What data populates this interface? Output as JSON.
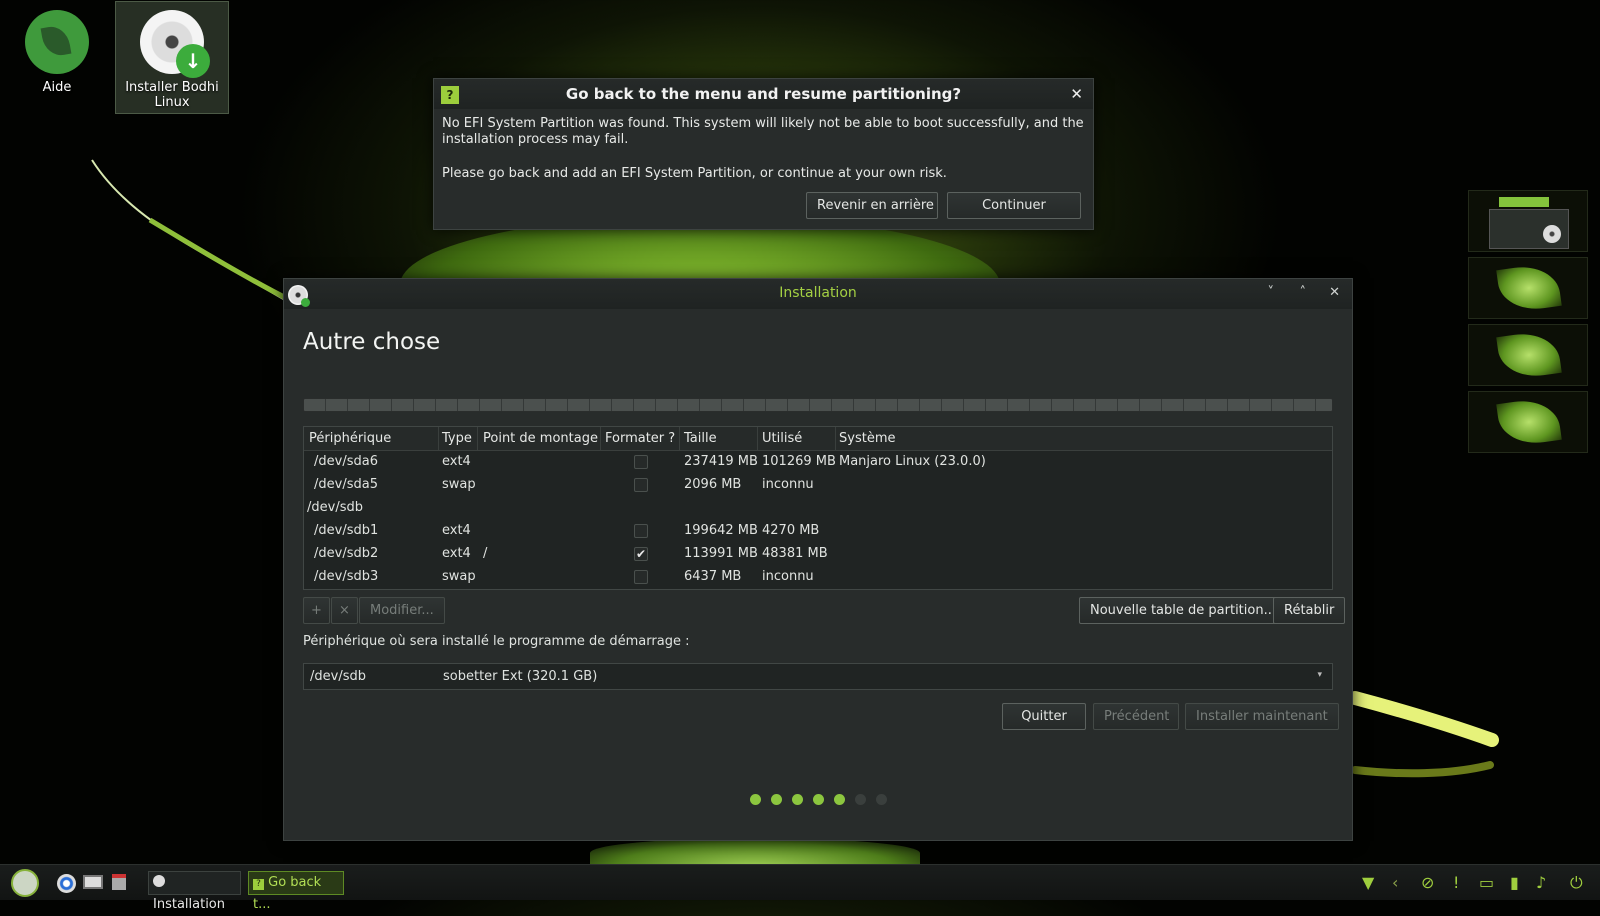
{
  "desktop": {
    "icons": [
      {
        "label": "Aide"
      },
      {
        "label": "Installer Bodhi Linux"
      }
    ]
  },
  "dialog": {
    "title": "Go back to the menu and resume partitioning?",
    "message_1": "No EFI System Partition was found. This system will likely not be able to boot successfully, and the installation process may fail.",
    "message_2": "Please go back and add an EFI System Partition, or continue at your own risk.",
    "back_label": "Revenir en arrière",
    "continue_label": "Continuer",
    "close_glyph": "✕",
    "question_glyph": "?"
  },
  "installer": {
    "window_title": "Installation",
    "minimize_glyph": "˅",
    "maximize_glyph": "˄",
    "close_glyph": "✕",
    "heading": "Autre chose",
    "columns": [
      "Périphérique",
      "Type",
      "Point de montage",
      "Formater ?",
      "Taille",
      "Utilisé",
      "Système"
    ],
    "rows": [
      {
        "device": "/dev/sda6",
        "type": "ext4",
        "mount": "",
        "format": false,
        "size": "237419 MB",
        "used": "101269 MB",
        "system": "Manjaro Linux (23.0.0)"
      },
      {
        "device": "/dev/sda5",
        "type": "swap",
        "mount": "",
        "format": false,
        "size": "2096 MB",
        "used": "inconnu",
        "system": ""
      },
      {
        "device": "/dev/sdb",
        "type": "",
        "mount": "",
        "format": null,
        "size": "",
        "used": "",
        "system": ""
      },
      {
        "device": "/dev/sdb1",
        "type": "ext4",
        "mount": "",
        "format": false,
        "size": "199642 MB",
        "used": "4270 MB",
        "system": ""
      },
      {
        "device": "/dev/sdb2",
        "type": "ext4",
        "mount": "/",
        "format": true,
        "size": "113991 MB",
        "used": "48381 MB",
        "system": ""
      },
      {
        "device": "/dev/sdb3",
        "type": "swap",
        "mount": "",
        "format": false,
        "size": "6437 MB",
        "used": "inconnu",
        "system": ""
      }
    ],
    "add_glyph": "+",
    "remove_glyph": "×",
    "modify_label": "Modifier...",
    "new_table_label": "Nouvelle table de partition...",
    "revert_label": "Rétablir",
    "bootloader_label": "Périphérique où sera installé le programme de démarrage :",
    "bootloader_device": "/dev/sdb",
    "bootloader_name": "sobetter Ext (320.1 GB)",
    "quit_label": "Quitter",
    "back_label": "Précédent",
    "install_label": "Installer maintenant",
    "progress": {
      "total_steps": 7,
      "completed_steps": 5
    }
  },
  "taskbar": {
    "tasks": [
      {
        "label": "Installation",
        "active": false
      },
      {
        "label": "Go back t...",
        "active": true
      }
    ]
  },
  "colors": {
    "accent": "#9fce3e",
    "dot_active": "#8cc63f",
    "dot_inactive": "#3a3f3d"
  }
}
